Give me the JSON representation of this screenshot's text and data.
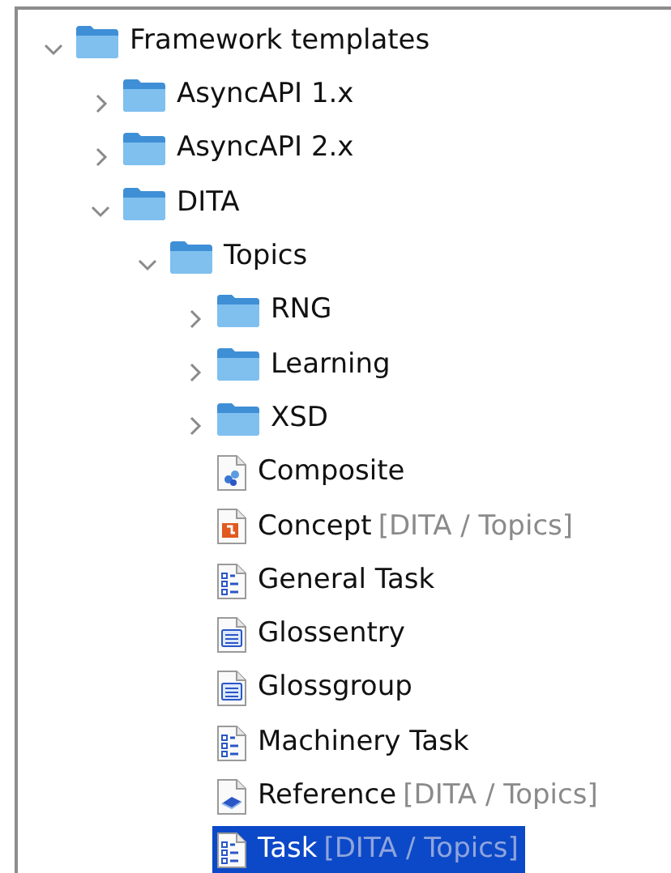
{
  "tree": [
    {
      "label": "Framework templates",
      "kind": "folder",
      "expanded": true,
      "selected": false,
      "children": [
        {
          "label": "AsyncAPI 1.x",
          "kind": "folder",
          "expanded": false,
          "selected": false
        },
        {
          "label": "AsyncAPI 2.x",
          "kind": "folder",
          "expanded": false,
          "selected": false
        },
        {
          "label": "DITA",
          "kind": "folder",
          "expanded": true,
          "selected": false,
          "children": [
            {
              "label": "Topics",
              "kind": "folder",
              "expanded": true,
              "selected": false,
              "children": [
                {
                  "label": "RNG",
                  "kind": "folder",
                  "expanded": false,
                  "selected": false
                },
                {
                  "label": "Learning",
                  "kind": "folder",
                  "expanded": false,
                  "selected": false
                },
                {
                  "label": "XSD",
                  "kind": "folder",
                  "expanded": false,
                  "selected": false
                },
                {
                  "label": "Composite",
                  "kind": "composite",
                  "selected": false
                },
                {
                  "label": "Concept",
                  "hint": "[DITA / Topics]",
                  "kind": "concept",
                  "selected": false
                },
                {
                  "label": "General Task",
                  "kind": "task",
                  "selected": false
                },
                {
                  "label": "Glossentry",
                  "kind": "glossary",
                  "selected": false
                },
                {
                  "label": "Glossgroup",
                  "kind": "glossary",
                  "selected": false
                },
                {
                  "label": "Machinery Task",
                  "kind": "task",
                  "selected": false
                },
                {
                  "label": "Reference",
                  "hint": "[DITA / Topics]",
                  "kind": "reference",
                  "selected": false
                },
                {
                  "label": "Task",
                  "hint": "[DITA / Topics]",
                  "kind": "task",
                  "selected": true
                }
              ]
            }
          ]
        }
      ]
    }
  ]
}
